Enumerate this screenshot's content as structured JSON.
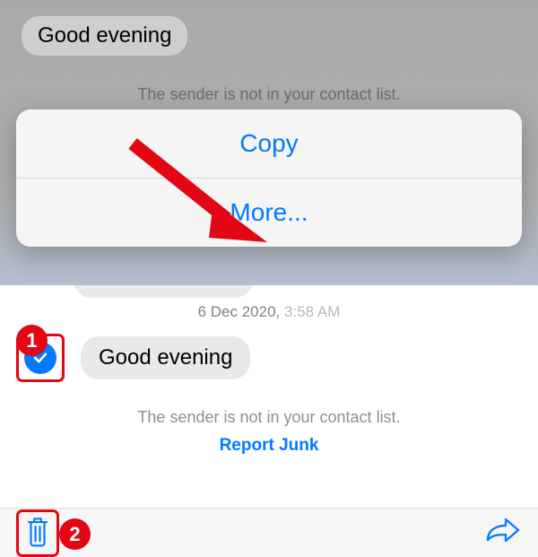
{
  "top": {
    "bubble_text": "Good evening",
    "warning_text": "The sender is not in your contact list."
  },
  "popup": {
    "copy_label": "Copy",
    "more_label": "More..."
  },
  "bottom": {
    "date_label": "6 Dec 2020,",
    "time_label": "3:58 AM",
    "bubble_text": "Good evening",
    "warning_text": "The sender is not in your contact list.",
    "report_junk_label": "Report Junk"
  },
  "annotations": {
    "badge1": "1",
    "badge2": "2"
  },
  "colors": {
    "ios_blue": "#007aff",
    "annotation_red": "#e30613",
    "bubble_gray": "#e9e9eb",
    "warning_gray": "#8e8e93"
  }
}
